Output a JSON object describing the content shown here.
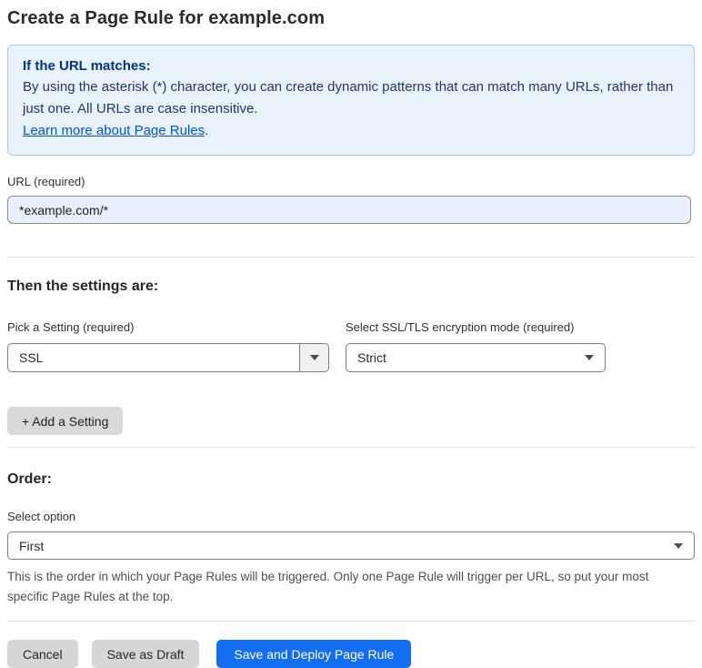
{
  "page": {
    "title": "Create a Page Rule for example.com"
  },
  "info_box": {
    "heading": "If the URL matches:",
    "body": "By using the asterisk (*) character, you can create dynamic patterns that can match many URLs, rather than just one. All URLs are case insensitive.",
    "link_label": "Learn more about Page Rules",
    "link_suffix": "."
  },
  "url_field": {
    "label": "URL (required)",
    "value": "*example.com/*"
  },
  "settings": {
    "heading": "Then the settings are:",
    "pick_setting": {
      "label": "Pick a Setting (required)",
      "value": "SSL"
    },
    "ssl_mode": {
      "label": "Select SSL/TLS encryption mode (required)",
      "value": "Strict"
    },
    "add_setting_label": "+ Add a Setting"
  },
  "order": {
    "heading": "Order:",
    "select_label": "Select option",
    "value": "First",
    "help_text": "This is the order in which your Page Rules will be triggered. Only one Page Rule will trigger per URL, so put your most specific Page Rules at the top."
  },
  "footer": {
    "cancel_label": "Cancel",
    "save_draft_label": "Save as Draft",
    "save_deploy_label": "Save and Deploy Page Rule"
  },
  "colors": {
    "accent_blue": "#146ef2",
    "info_bg": "#e9f1fb",
    "info_border": "#a9c9ee",
    "info_heading_text": "#003681",
    "link": "#0055dc",
    "input_bg": "#e8f0fe"
  },
  "icons": {
    "dropdown_caret": "caret-down"
  }
}
